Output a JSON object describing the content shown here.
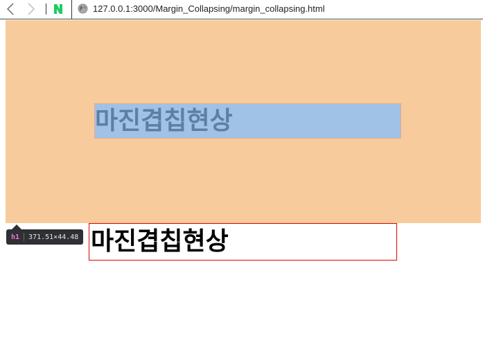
{
  "browser": {
    "url": "127.0.0.1:3000/Margin_Collapsing/margin_collapsing.html",
    "naver_label": "N"
  },
  "page": {
    "highlighted_heading": "마진겹칩현상",
    "heading": "마진겹칩현상"
  },
  "devtools_tooltip": {
    "tag": "h1",
    "dimensions": "371.51×44.48"
  },
  "colors": {
    "orange_background": "#f7cb9c",
    "highlight_blue": "#9fc2e6",
    "heading_border": "#e00000",
    "naver_green": "#19ce60"
  },
  "icons": {
    "back": "chevron-left-icon",
    "forward": "chevron-right-icon",
    "site": "globe-icon",
    "naver": "naver-logo-icon"
  }
}
